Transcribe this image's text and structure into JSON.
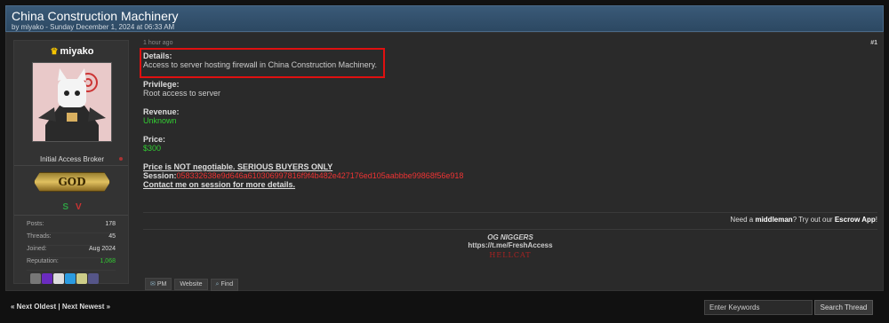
{
  "thread": {
    "title": "China Construction Machinery",
    "byline": "by miyako - Sunday December 1, 2024 at 06:33 AM"
  },
  "user": {
    "name": "miyako",
    "title": "Initial Access Broker",
    "rank": "GOD",
    "badges": {
      "s": "S",
      "v": "V"
    },
    "stats": [
      {
        "label": "Posts:",
        "value": "178"
      },
      {
        "label": "Threads:",
        "value": "45"
      },
      {
        "label": "Joined:",
        "value": "Aug 2024"
      },
      {
        "label": "Reputation:",
        "value": "1,068"
      }
    ],
    "award_colors": [
      "#777",
      "#6a2bbf",
      "#ddd",
      "#2b9be0",
      "#cc8",
      "#558"
    ]
  },
  "post": {
    "time": "1 hour ago",
    "number": "#1",
    "details_label": "Details:",
    "details_value": "Access to server hosting firewall in China Construction Machinery.",
    "privilege_label": "Privilege:",
    "privilege_value": "Root access to server",
    "revenue_label": "Revenue:",
    "revenue_value": "Unknown",
    "price_label": "Price:",
    "price_value": "$300",
    "notice": "Price is NOT negotiable. SERIOUS BUYERS ONLY",
    "session_label": "Session:",
    "session_value": "058332638e9d646a610306997816f9f4b482e427176ed105aabbbe99868f56e918",
    "contact": "Contact me on session for more details."
  },
  "middleman": {
    "pre": "Need a ",
    "bold1": "middleman",
    "mid": "? Try out our ",
    "bold2": "Escrow App",
    "post": "!"
  },
  "signature": {
    "line1": "OG NIGGERS",
    "line2": "https://t.me/FreshAccess",
    "line3": "HELLCAT"
  },
  "actions": {
    "pm": "PM",
    "website": "Website",
    "find": "Find"
  },
  "footer": {
    "next_oldest": "« Next Oldest",
    "divider": " | ",
    "next_newest": "Next Newest »",
    "keywords_value": "Enter Keywords",
    "search_button": "Search Thread"
  },
  "colors": {
    "highlight": "#e01010",
    "green": "#33cc33",
    "red": "#ee3333"
  }
}
